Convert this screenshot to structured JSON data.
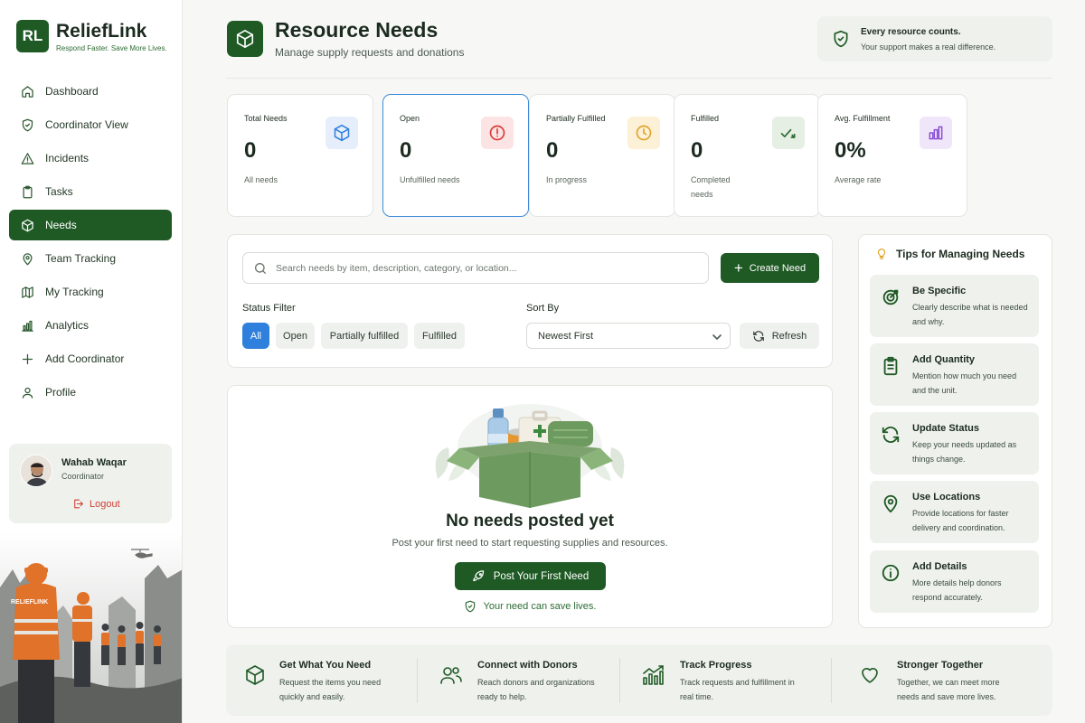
{
  "brand": {
    "logo": "RL",
    "name": "ReliefLink",
    "tagline": "Respond Faster. Save More Lives."
  },
  "nav": [
    {
      "label": "Dashboard",
      "icon": "home-icon"
    },
    {
      "label": "Coordinator View",
      "icon": "shield-check-icon"
    },
    {
      "label": "Incidents",
      "icon": "warning-icon"
    },
    {
      "label": "Tasks",
      "icon": "clipboard-icon"
    },
    {
      "label": "Needs",
      "icon": "box-icon",
      "active": true
    },
    {
      "label": "Team Tracking",
      "icon": "location-pin-icon"
    },
    {
      "label": "My Tracking",
      "icon": "map-icon"
    },
    {
      "label": "Analytics",
      "icon": "bar-chart-icon"
    },
    {
      "label": "Add Coordinator",
      "icon": "plus-icon"
    },
    {
      "label": "Profile",
      "icon": "user-icon"
    }
  ],
  "user": {
    "name": "Wahab Waqar",
    "role": "Coordinator",
    "logout": "Logout"
  },
  "hero": {
    "vest_text": "RELIEFLINK"
  },
  "header": {
    "title": "Resource Needs",
    "subtitle": "Manage supply requests and donations"
  },
  "banner": {
    "title": "Every resource counts.",
    "text": "Your support makes a real difference."
  },
  "stats": [
    {
      "label": "Total Needs",
      "value": "0",
      "sub": "All needs",
      "icon": "box-icon",
      "color": "#2f7fdc"
    },
    {
      "label": "Open",
      "value": "0",
      "sub": "Unfulfilled needs",
      "icon": "alert-circle-icon",
      "color": "#d93b3b"
    },
    {
      "label": "Partially Fulfilled",
      "value": "0",
      "sub": "In progress",
      "icon": "clock-icon",
      "color": "#e0a52c"
    },
    {
      "label": "Fulfilled",
      "value": "0",
      "sub": "Completed needs",
      "icon": "check-trend-icon",
      "color": "#2d6b33"
    },
    {
      "label": "Avg. Fulfillment",
      "value": "0%",
      "sub": "Average rate",
      "icon": "bar-chart-icon",
      "color": "#8a4fd6"
    }
  ],
  "search": {
    "placeholder": "Search needs by item, description, category, or location..."
  },
  "create_button": "Create Need",
  "filters": {
    "status_label": "Status Filter",
    "chips": [
      "All",
      "Open",
      "Partially fulfilled",
      "Fulfilled"
    ],
    "active_chip": "All",
    "sort_label": "Sort By",
    "sort_value": "Newest First",
    "refresh": "Refresh"
  },
  "empty": {
    "title": "No needs posted yet",
    "subtitle": "Post your first need to start requesting supplies and resources.",
    "button": "Post Your First Need",
    "note": "Your need can save lives."
  },
  "tips": {
    "title": "Tips for Managing Needs",
    "items": [
      {
        "title": "Be Specific",
        "text": "Clearly describe what is needed and why.",
        "icon": "target-icon"
      },
      {
        "title": "Add Quantity",
        "text": "Mention how much you need and the unit.",
        "icon": "clipboard-list-icon"
      },
      {
        "title": "Update Status",
        "text": "Keep your needs updated as things change.",
        "icon": "refresh-icon"
      },
      {
        "title": "Use Locations",
        "text": "Provide locations for faster delivery and coordination.",
        "icon": "location-pin-icon"
      },
      {
        "title": "Add Details",
        "text": "More details help donors respond accurately.",
        "icon": "info-icon"
      }
    ]
  },
  "features": [
    {
      "title": "Get What You Need",
      "text": "Request the items you need quickly and easily.",
      "icon": "box-icon"
    },
    {
      "title": "Connect with Donors",
      "text": "Reach donors and organizations ready to help.",
      "icon": "users-icon"
    },
    {
      "title": "Track Progress",
      "text": "Track requests and fulfillment in real time.",
      "icon": "trend-chart-icon"
    },
    {
      "title": "Stronger Together",
      "text": "Together, we can meet more needs and save more lives.",
      "icon": "heart-icon"
    }
  ]
}
